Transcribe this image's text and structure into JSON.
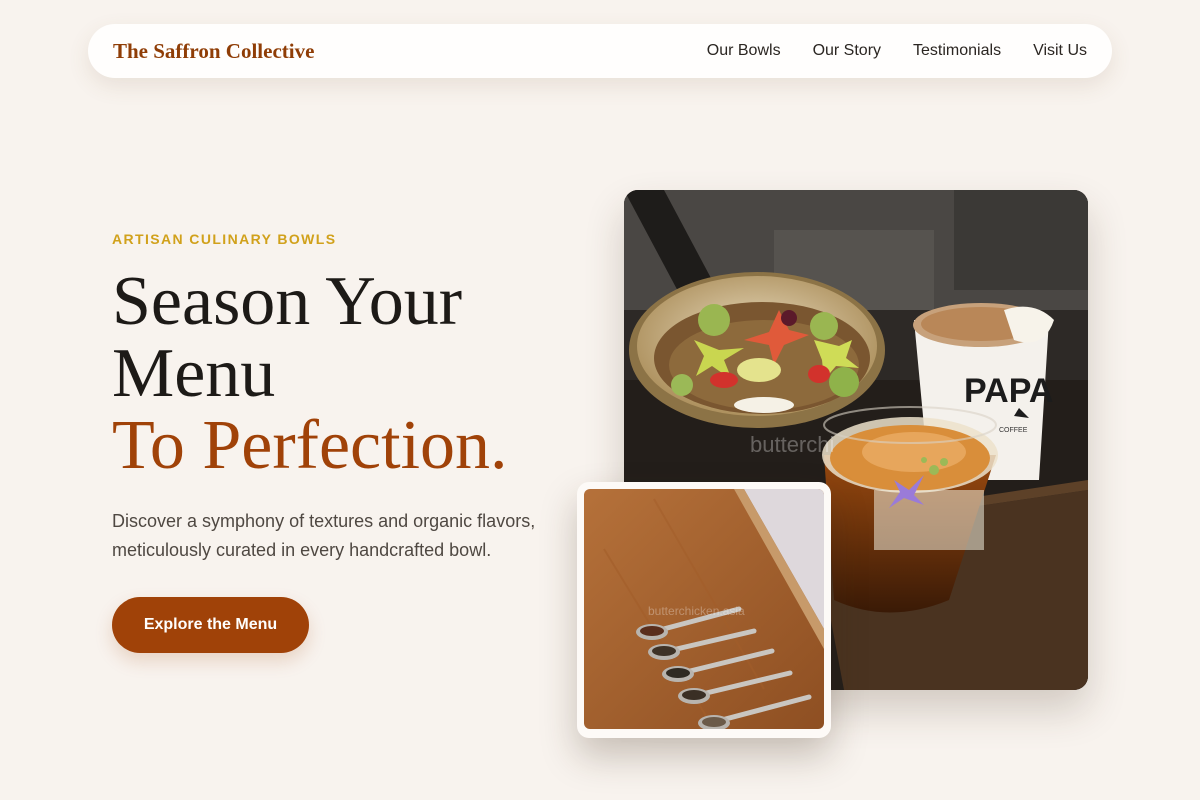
{
  "nav": {
    "brand": "The Saffron Collective",
    "links": [
      {
        "label": "Our Bowls"
      },
      {
        "label": "Our Story"
      },
      {
        "label": "Testimonials"
      },
      {
        "label": "Visit Us"
      }
    ]
  },
  "hero": {
    "eyebrow": "ARTISAN CULINARY BOWLS",
    "headline_line1": "Season Your",
    "headline_line2": "Menu",
    "headline_accent": "To Perfection.",
    "lead": "Discover a symphony of textures and organic flavors, meticulously curated in every handcrafted bowl.",
    "cta_label": "Explore the Menu"
  },
  "images": {
    "main_photo": {
      "cup_print": "PAPA",
      "cup_subprint": "COFFEE",
      "watermark": "butterchi"
    },
    "small_photo": {
      "watermark": "butterchicken.asia"
    }
  },
  "colors": {
    "background": "#f8f3ee",
    "brand": "#8f3d06",
    "accent": "#a04208",
    "eyebrow": "#d1a11b",
    "text": "#1d1a17"
  }
}
